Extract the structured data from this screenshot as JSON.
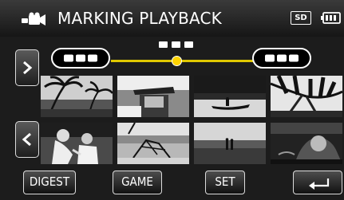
{
  "header": {
    "title": "MARKING PLAYBACK",
    "mode_icon": "video-camera-icon",
    "storage_badge": "SD",
    "battery_icon": "battery-icon"
  },
  "colors": {
    "header_bg": "#2a2a2a",
    "scrub_track": "#e0c800",
    "scrub_knob": "#ffd400",
    "button_border": "#dcdcdc",
    "text": "#ffffff"
  },
  "scrubber": {
    "start_pill_icon": "marker-dots-icon",
    "end_pill_icon": "marker-dots-icon",
    "marker_icon": "marker-dots-icon"
  },
  "navigation": {
    "next_icon": "chevron-right-icon",
    "prev_icon": "chevron-left-icon"
  },
  "thumbnails": [
    {
      "subject": "palm-trees"
    },
    {
      "subject": "person-hat"
    },
    {
      "subject": "canoe-lake"
    },
    {
      "subject": "palm-leaves"
    },
    {
      "subject": "children-playing"
    },
    {
      "subject": "beach-chair"
    },
    {
      "subject": "couple-beach"
    },
    {
      "subject": "beach-splash"
    }
  ],
  "footer": {
    "digest_label": "DIGEST",
    "game_label": "GAME",
    "set_label": "SET",
    "back_icon": "back-return-icon"
  }
}
